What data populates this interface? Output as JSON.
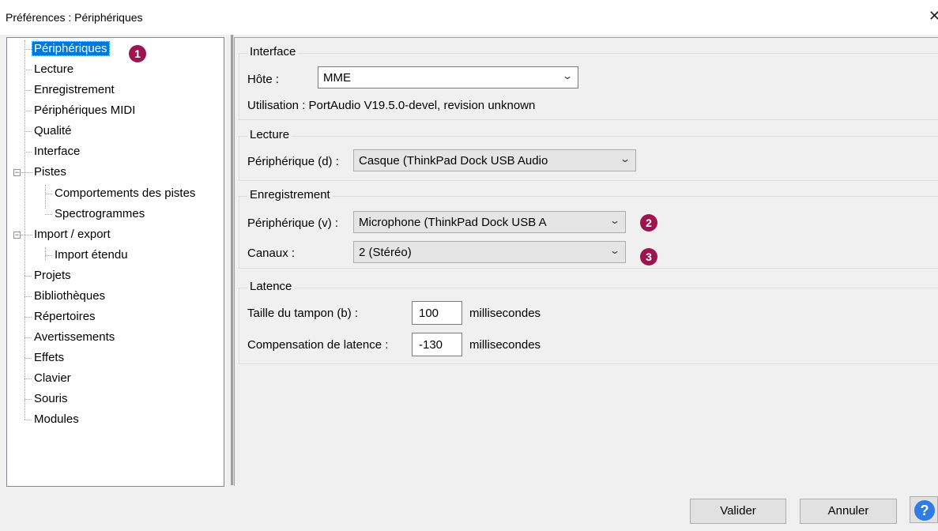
{
  "window": {
    "title": "Préférences : Périphériques"
  },
  "tree": {
    "items": [
      {
        "label": "Périphériques",
        "selected": true
      },
      {
        "label": "Lecture"
      },
      {
        "label": "Enregistrement"
      },
      {
        "label": "Périphériques MIDI"
      },
      {
        "label": "Qualité"
      },
      {
        "label": "Interface"
      },
      {
        "label": "Pistes",
        "expanded": true
      },
      {
        "label": "Comportements des pistes"
      },
      {
        "label": "Spectrogrammes"
      },
      {
        "label": "Import / export",
        "expanded": true
      },
      {
        "label": "Import étendu"
      },
      {
        "label": "Projets"
      },
      {
        "label": "Bibliothèques"
      },
      {
        "label": "Répertoires"
      },
      {
        "label": "Avertissements"
      },
      {
        "label": "Effets"
      },
      {
        "label": "Clavier"
      },
      {
        "label": "Souris"
      },
      {
        "label": "Modules"
      }
    ]
  },
  "interface": {
    "title": "Interface",
    "host_label": "Hôte :",
    "host_value": "MME",
    "usage_text": "Utilisation : PortAudio V19.5.0-devel, revision unknown"
  },
  "playback": {
    "title": "Lecture",
    "device_label": "Périphérique (d) :",
    "device_value": "Casque (ThinkPad Dock USB Audio"
  },
  "recording": {
    "title": "Enregistrement",
    "device_label": "Périphérique (v) :",
    "device_value": "Microphone (ThinkPad Dock USB A",
    "channels_label": "Canaux :",
    "channels_value": "2 (Stéréo)"
  },
  "latency": {
    "title": "Latence",
    "buffer_label": "Taille du tampon (b) :",
    "buffer_value": "100",
    "buffer_unit": "millisecondes",
    "compensation_label": "Compensation de latence :",
    "compensation_value": "-130",
    "compensation_unit": "millisecondes"
  },
  "markers": [
    "1",
    "2",
    "3"
  ],
  "buttons": {
    "ok": "Valider",
    "cancel": "Annuler",
    "help": "?"
  },
  "colors": {
    "selection": "#0078d7",
    "marker": "#9c1551",
    "help": "#2f7de1"
  }
}
